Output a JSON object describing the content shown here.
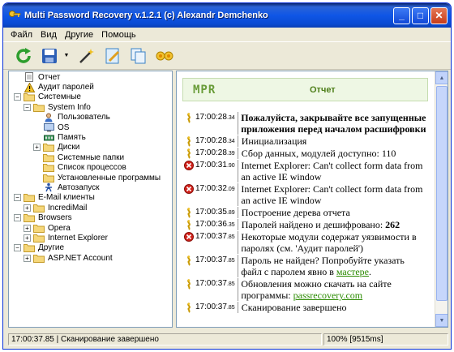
{
  "window": {
    "title": "Multi Password Recovery v.1.2.1 (c) Alexandr Demchenko",
    "minimize": "_",
    "maximize": "□",
    "close": "✕"
  },
  "menu": [
    "Файл",
    "Вид",
    "Другие",
    "Помощь"
  ],
  "toolbar": {
    "buttons": [
      "refresh-icon",
      "save-icon",
      "magic-wand-icon",
      "edit-icon",
      "copy-icon",
      "flowers-icon"
    ]
  },
  "tree": [
    {
      "label": "Отчет",
      "level": 0,
      "icon": "report-icon",
      "expander": ""
    },
    {
      "label": "Аудит паролей",
      "level": 0,
      "icon": "warning-icon",
      "expander": ""
    },
    {
      "label": "Системные",
      "level": 0,
      "icon": "folder-icon",
      "expander": "−"
    },
    {
      "label": "System Info",
      "level": 1,
      "icon": "folder-icon",
      "expander": "−"
    },
    {
      "label": "Пользователь",
      "level": 2,
      "icon": "user-icon",
      "expander": ""
    },
    {
      "label": "OS",
      "level": 2,
      "icon": "os-icon",
      "expander": ""
    },
    {
      "label": "Память",
      "level": 2,
      "icon": "memory-icon",
      "expander": ""
    },
    {
      "label": "Диски",
      "level": 2,
      "icon": "folder-icon",
      "expander": "+"
    },
    {
      "label": "Системные папки",
      "level": 2,
      "icon": "folder-icon",
      "expander": ""
    },
    {
      "label": "Список процессов",
      "level": 2,
      "icon": "folder-icon",
      "expander": ""
    },
    {
      "label": "Установленные программы",
      "level": 2,
      "icon": "folder-icon",
      "expander": ""
    },
    {
      "label": "Автозапуск",
      "level": 2,
      "icon": "autorun-icon",
      "expander": ""
    },
    {
      "label": "E-Mail клиенты",
      "level": 0,
      "icon": "folder-icon",
      "expander": "−"
    },
    {
      "label": "IncrediMail",
      "level": 1,
      "icon": "folder-icon",
      "expander": "+"
    },
    {
      "label": "Browsers",
      "level": 0,
      "icon": "folder-icon",
      "expander": "−"
    },
    {
      "label": "Opera",
      "level": 1,
      "icon": "folder-icon",
      "expander": "+"
    },
    {
      "label": "Internet Explorer",
      "level": 1,
      "icon": "folder-icon",
      "expander": "+"
    },
    {
      "label": "Другие",
      "level": 0,
      "icon": "folder-icon",
      "expander": "−"
    },
    {
      "label": "ASP.NET Account",
      "level": 1,
      "icon": "folder-icon",
      "expander": "+"
    }
  ],
  "report": {
    "logo": "MPR",
    "title": "Отчет",
    "entries": [
      {
        "icon": "info",
        "time": "17:00:28",
        "ms": "34",
        "msg": "Пожалуйста, закрывайте все запущенные приложения перед началом расшифровки",
        "bold": true
      },
      {
        "icon": "info",
        "time": "17:00:28",
        "ms": "34",
        "msg": "Инициализация",
        "bold": false
      },
      {
        "icon": "info",
        "time": "17:00:28",
        "ms": "39",
        "msg": "Сбор данных, модулей доступно: 110",
        "bold": false
      },
      {
        "icon": "error",
        "time": "17:00:31",
        "ms": "90",
        "msg": "Internet Explorer: Can't collect form data from an active IE window",
        "bold": false
      },
      {
        "icon": "error",
        "time": "17:00:32",
        "ms": "09",
        "msg": "Internet Explorer: Can't collect form data from an active IE window",
        "bold": false
      },
      {
        "icon": "info",
        "time": "17:00:35",
        "ms": "89",
        "msg": "Построение дерева отчета",
        "bold": false
      },
      {
        "icon": "info",
        "time": "17:00:36",
        "ms": "35",
        "msg": "Паролей найдено и дешифровано: ",
        "strong": "262",
        "bold": false
      },
      {
        "icon": "error",
        "time": "17:00:37",
        "ms": "85",
        "msg": "Некоторые модули содержат уязвимости в паролях (см. 'Аудит паролей')",
        "bold": false
      },
      {
        "icon": "info",
        "time": "17:00:37",
        "ms": "85",
        "msg": "Пароль не найден? Попробуйте указать файл с паролем явно в ",
        "link": "мастере",
        "tail": ".",
        "bold": false
      },
      {
        "icon": "info",
        "time": "17:00:37",
        "ms": "85",
        "msg": "Обновления можно скачать на сайте программы: ",
        "link": "passrecovery.com",
        "tail": "",
        "bold": false
      },
      {
        "icon": "info",
        "time": "17:00:37",
        "ms": "85",
        "msg": "Сканирование завершено",
        "bold": false
      }
    ]
  },
  "status": {
    "left": "17:00:37.85 | Сканирование завершено",
    "right": "100% [9515ms]"
  }
}
